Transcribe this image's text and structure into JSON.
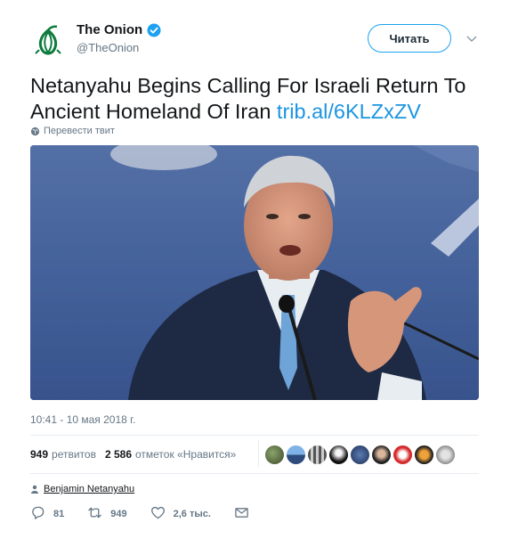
{
  "account": {
    "name": "The Onion",
    "handle": "@TheOnion",
    "follow_label": "Читать",
    "brand_color": "#0c7a3c",
    "verified_color": "#1da1f2"
  },
  "tweet": {
    "text": "Netanyahu Begins Calling For Israeli Return To Ancient Homeland Of Iran ",
    "link": "trib.al/6KLZxZV",
    "translate_label": "Перевести твит",
    "timestamp": "10:41 - 10 мая 2018 г."
  },
  "stats": {
    "retweets_count": "949",
    "retweets_label": "ретвитов",
    "likes_count": "2 586",
    "likes_label": "отметок «Нравится»"
  },
  "mention": {
    "label": "Benjamin Netanyahu"
  },
  "actions": {
    "reply_count": "81",
    "retweet_count": "949",
    "like_count": "2,6 тыс."
  }
}
